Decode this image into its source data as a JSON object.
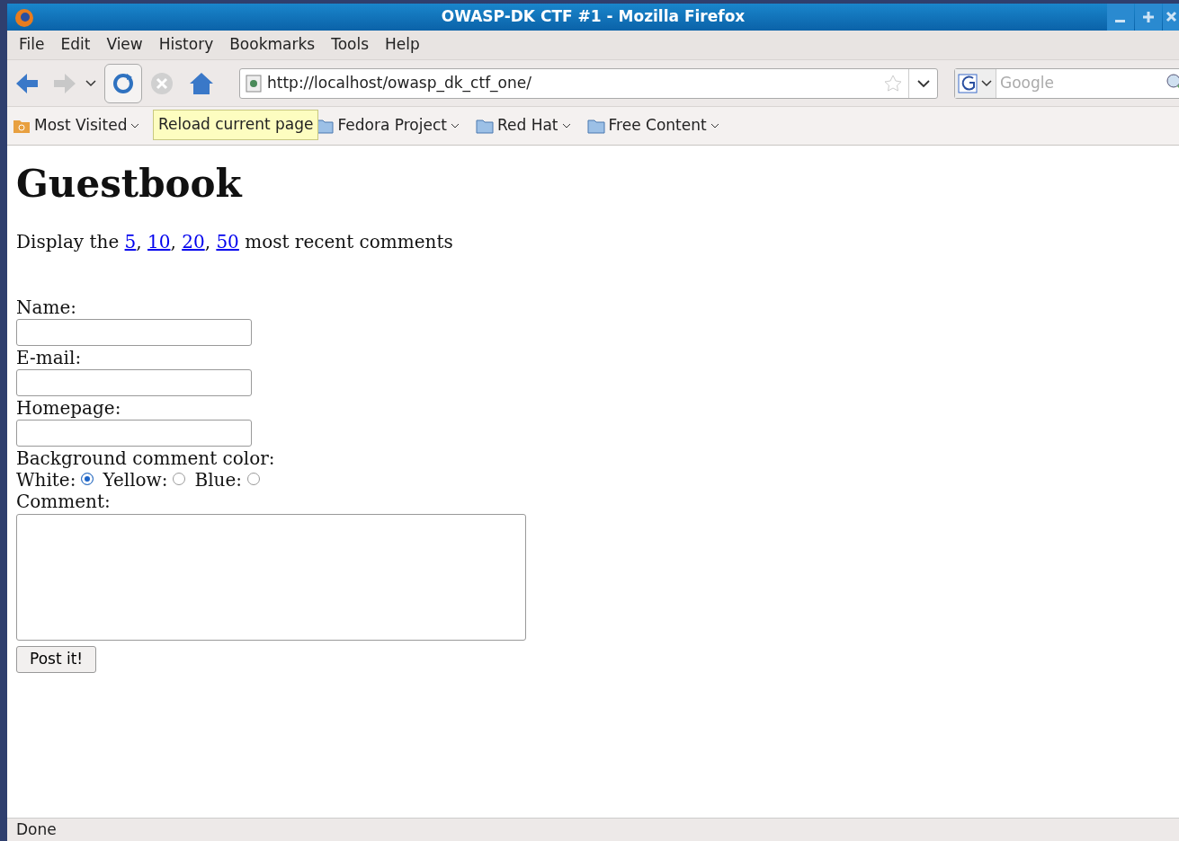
{
  "window": {
    "title": "OWASP-DK CTF #1 - Mozilla Firefox"
  },
  "menu": [
    "File",
    "Edit",
    "View",
    "History",
    "Bookmarks",
    "Tools",
    "Help"
  ],
  "toolbar": {
    "url": "http://localhost/owasp_dk_ctf_one/",
    "search_placeholder": "Google"
  },
  "tooltip": "Reload current page",
  "bookmarks": [
    {
      "label": "Most Visited",
      "kind": "smart"
    },
    {
      "label": "Fedora Project",
      "kind": "folder"
    },
    {
      "label": "Red Hat",
      "kind": "folder"
    },
    {
      "label": "Free Content",
      "kind": "folder"
    }
  ],
  "page": {
    "heading": "Guestbook",
    "display": {
      "before": "Display the",
      "links": [
        "5",
        "10",
        "20",
        "50"
      ],
      "separator": ",",
      "after": "most recent comments"
    },
    "fields": [
      {
        "label": "Name:",
        "kind": "text"
      },
      {
        "label": "E-mail:",
        "kind": "text"
      },
      {
        "label": "Homepage:",
        "kind": "text"
      }
    ],
    "color_label": "Background comment color:",
    "colors": [
      {
        "label": "White:",
        "selected": true
      },
      {
        "label": "Yellow:",
        "selected": false
      },
      {
        "label": "Blue:",
        "selected": false
      }
    ],
    "comment_label": "Comment:",
    "submit": "Post it!"
  },
  "status_bar": "Done"
}
